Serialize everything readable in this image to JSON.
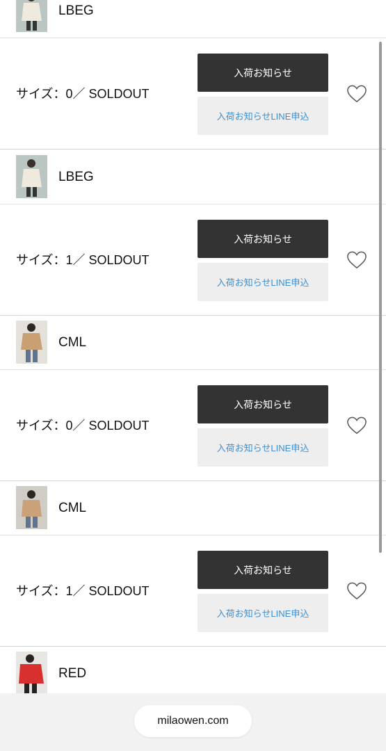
{
  "rows": [
    {
      "color": {
        "name": "LBEG",
        "thumb": "woman-in-beige-trench-jacket"
      },
      "size": {
        "label": "サイズ：0／ SOLDOUT",
        "notify_button": "入荷お知らせ",
        "line_button": "入荷お知らせLINE申込",
        "favorite_icon": "heart-outline-icon"
      }
    },
    {
      "color": {
        "name": "LBEG",
        "thumb": "woman-in-beige-trench-jacket"
      },
      "size": {
        "label": "サイズ：1／ SOLDOUT",
        "notify_button": "入荷お知らせ",
        "line_button": "入荷お知らせLINE申込",
        "favorite_icon": "heart-outline-icon"
      }
    },
    {
      "color": {
        "name": "CML",
        "thumb": "woman-in-camel-jacket"
      },
      "size": {
        "label": "サイズ：0／ SOLDOUT",
        "notify_button": "入荷お知らせ",
        "line_button": "入荷お知らせLINE申込",
        "favorite_icon": "heart-outline-icon"
      }
    },
    {
      "color": {
        "name": "CML",
        "thumb": "woman-in-camel-jacket"
      },
      "size": {
        "label": "サイズ：1／ SOLDOUT",
        "notify_button": "入荷お知らせ",
        "line_button": "入荷お知らせLINE申込",
        "favorite_icon": "heart-outline-icon"
      }
    }
  ],
  "partial_row": {
    "name": "RED",
    "thumb": "woman-in-red-jacket"
  },
  "browser": {
    "url": "milaowen.com"
  },
  "colors": {
    "notify_bg": "#333333",
    "line_bg": "#eeeeee",
    "line_text": "#3d8fd1",
    "bottom_bar": "#f2f2f2"
  }
}
